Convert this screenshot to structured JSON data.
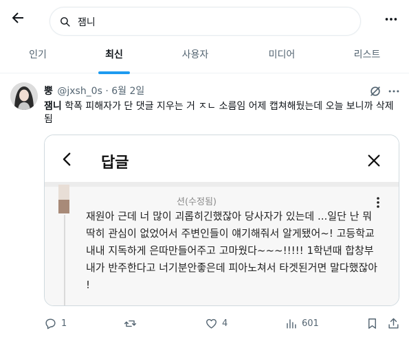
{
  "search": {
    "query": "잼니"
  },
  "tabs": [
    {
      "label": "인기"
    },
    {
      "label": "최신"
    },
    {
      "label": "사용자"
    },
    {
      "label": "미디어"
    },
    {
      "label": "리스트"
    }
  ],
  "tweet": {
    "display_name": "뿡",
    "meta": "@jxsh_0s · 6월 2일",
    "keyword": "잼니",
    "text": " 학폭 피해자가 단 댓글 지우는 거 ㅈㄴ 소름임 어제 캡쳐해뒀는데 오늘 보니까 삭제됨"
  },
  "media": {
    "title": "답글",
    "comment_user": "션(수정됨)",
    "comment_text": "재원아 근데 너 많이 괴롭히긴했잖아 당사자가 있는데 ...일단 난 뭐 딱히 관심이 없었어서 주변인들이 얘기해줘서 알게됐어~! 고등학교내내 지독하게 은따만들어주고 고마웠다~~~!!!!! 1학년때 합창부 내가 반주한다고 너기분안좋은데 피아노쳐서 타겟된거면 말다했잖아 !"
  },
  "actions": {
    "replies": "1",
    "retweets": "",
    "likes": "4",
    "views": "601"
  },
  "colors": {
    "accent": "#1d9bf0",
    "text": "#0f1419",
    "muted": "#536471"
  }
}
